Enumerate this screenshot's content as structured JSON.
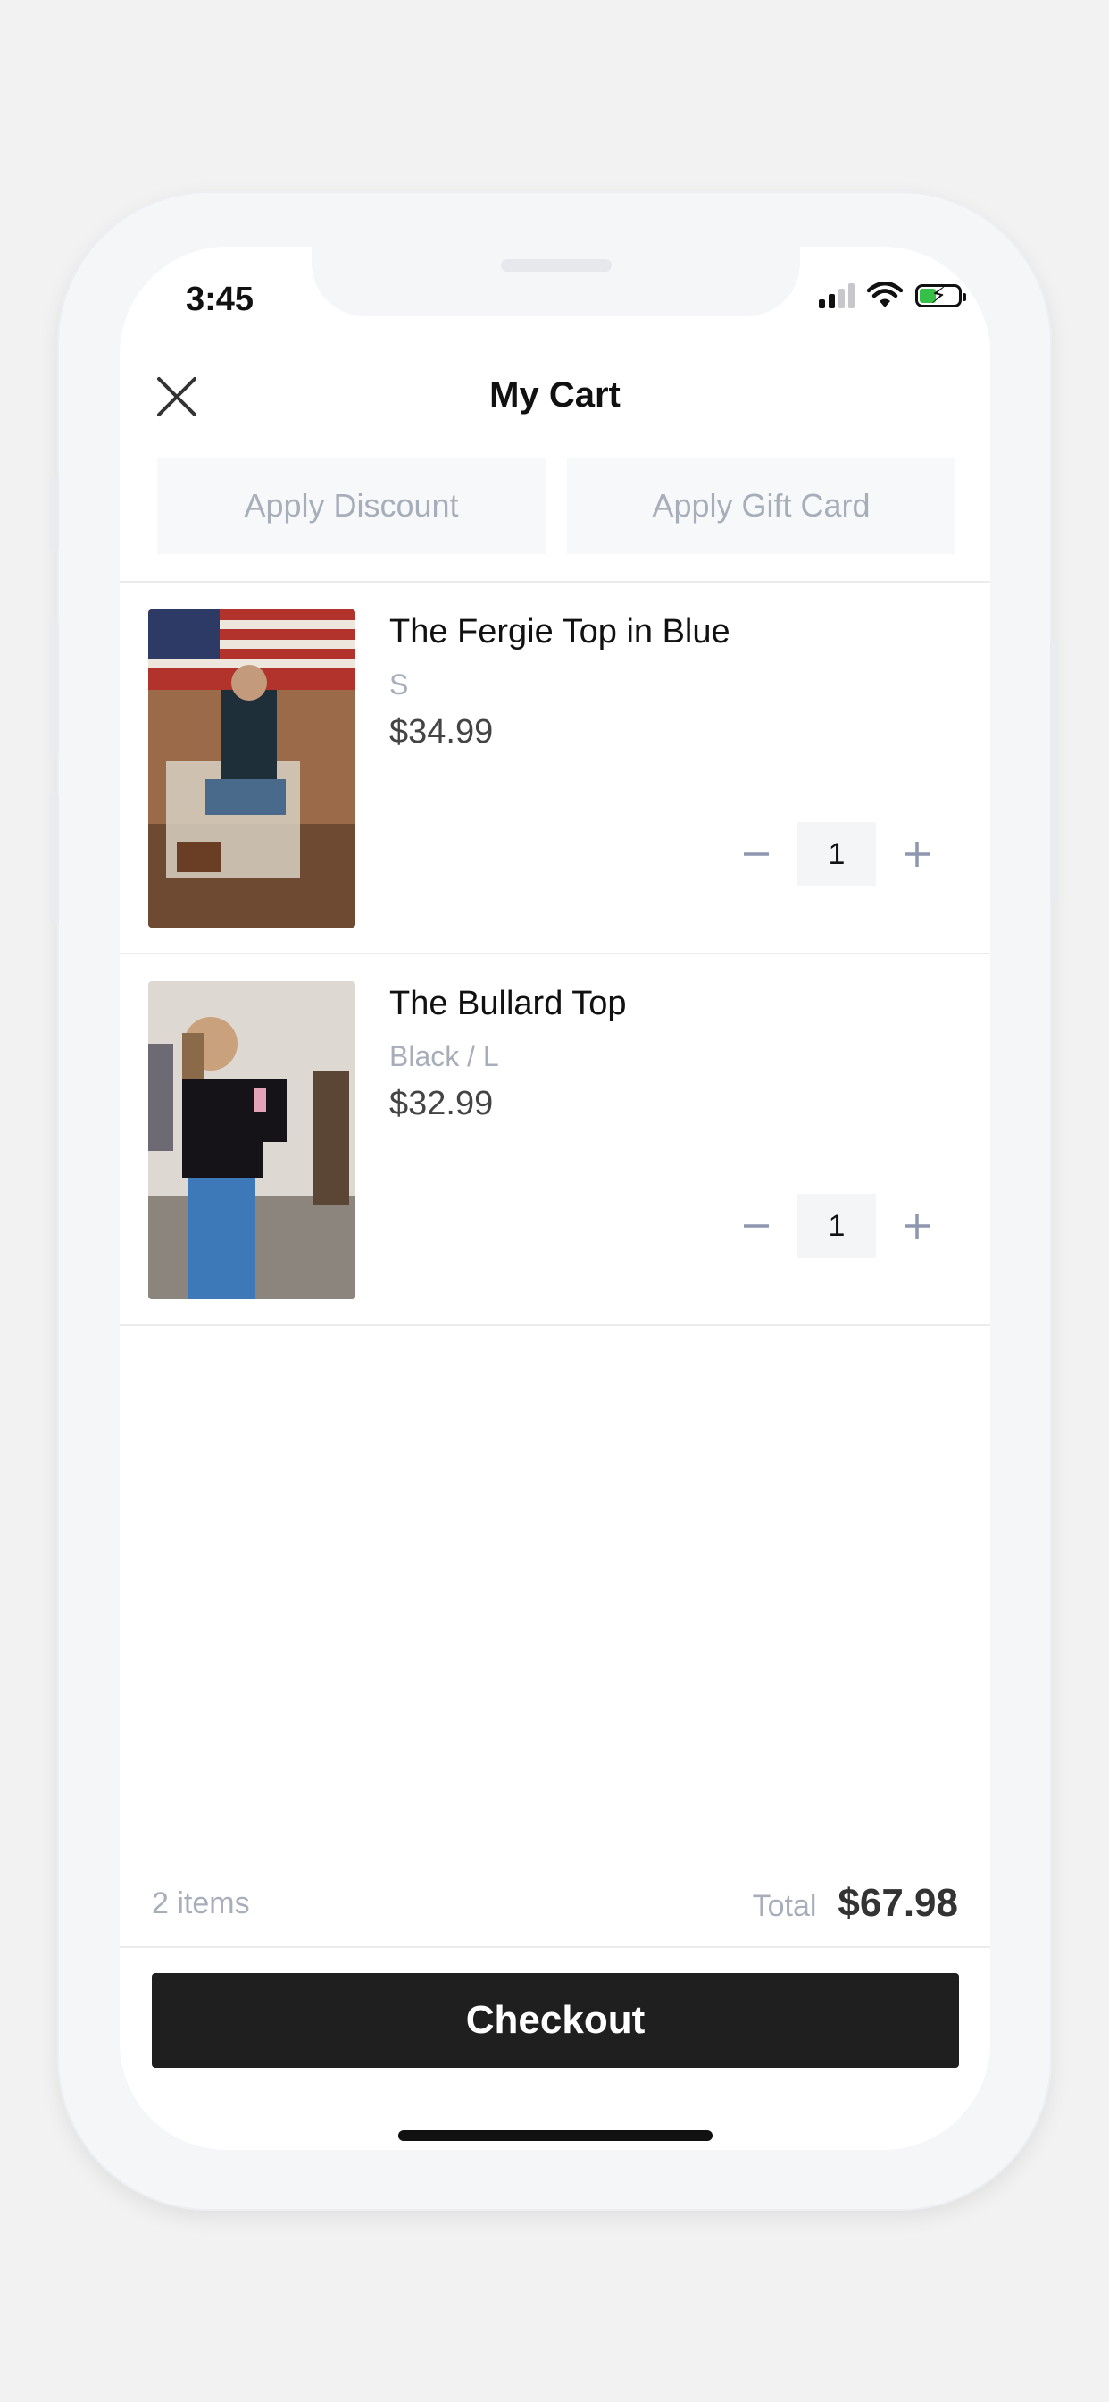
{
  "status_bar": {
    "time": "3:45"
  },
  "header": {
    "title": "My Cart",
    "close_icon": "close-icon"
  },
  "actions": {
    "apply_discount": "Apply Discount",
    "apply_gift_card": "Apply Gift Card"
  },
  "cart": {
    "items": [
      {
        "name": "The Fergie Top in Blue",
        "variant": "S",
        "price": "$34.99",
        "quantity": "1"
      },
      {
        "name": "The Bullard Top",
        "variant": "Black / L",
        "price": "$32.99",
        "quantity": "1"
      }
    ]
  },
  "summary": {
    "items_count": "2 items",
    "total_label": "Total",
    "total_value": "$67.98"
  },
  "checkout": {
    "label": "Checkout"
  },
  "colors": {
    "accent": "#1f1f1f",
    "muted": "#a8adba",
    "qty_icon": "#8e96b0",
    "battery": "#36c04a"
  }
}
